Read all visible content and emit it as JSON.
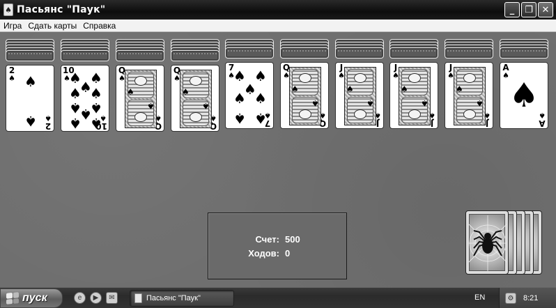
{
  "window": {
    "title": "Пасьянс \"Паук\"",
    "buttons": {
      "minimize": "_",
      "maximize": "❐",
      "close": "✕"
    }
  },
  "menu": {
    "items": [
      "Игра",
      "Сдать карты",
      "Справка"
    ]
  },
  "tableau": {
    "columns": [
      {
        "face_down": 5,
        "card": {
          "rank": "2",
          "suit": "♠"
        }
      },
      {
        "face_down": 5,
        "card": {
          "rank": "10",
          "suit": "♠"
        }
      },
      {
        "face_down": 5,
        "card": {
          "rank": "Q",
          "suit": "♠"
        }
      },
      {
        "face_down": 5,
        "card": {
          "rank": "Q",
          "suit": "♠"
        }
      },
      {
        "face_down": 4,
        "card": {
          "rank": "7",
          "suit": "♠"
        }
      },
      {
        "face_down": 4,
        "card": {
          "rank": "Q",
          "suit": "♠"
        }
      },
      {
        "face_down": 4,
        "card": {
          "rank": "J",
          "suit": "♠"
        }
      },
      {
        "face_down": 4,
        "card": {
          "rank": "J",
          "suit": "♠"
        }
      },
      {
        "face_down": 4,
        "card": {
          "rank": "J",
          "suit": "♠"
        }
      },
      {
        "face_down": 4,
        "card": {
          "rank": "A",
          "suit": "♠"
        }
      }
    ]
  },
  "score": {
    "score_label": "Счет:",
    "score_value": "500",
    "moves_label": "Ходов:",
    "moves_value": "0"
  },
  "stock": {
    "piles": 5
  },
  "taskbar": {
    "start_label": "пуск",
    "task_label": "Пасьянс \"Паук\"",
    "language": "EN",
    "clock": "8:21"
  }
}
